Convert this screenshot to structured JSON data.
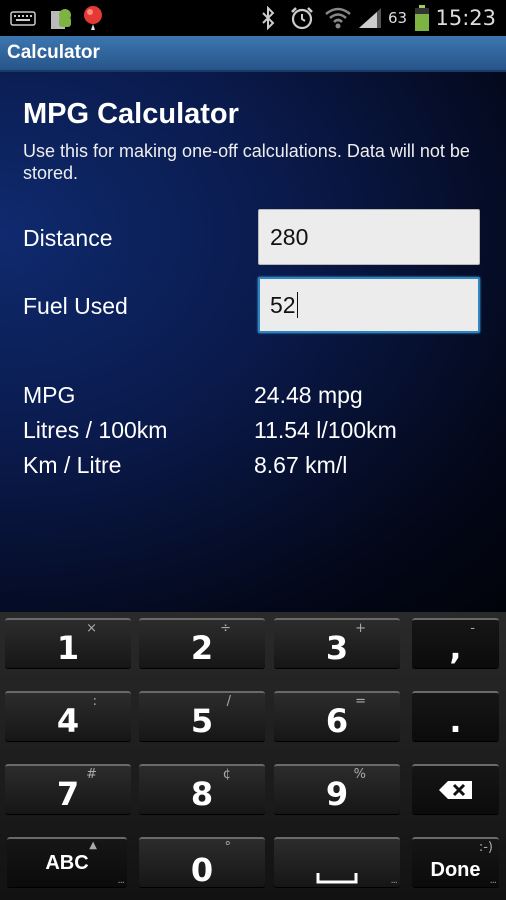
{
  "status_bar": {
    "icons": [
      "keyboard-icon",
      "android-sd-icon",
      "balloon-notification-icon",
      "bluetooth-icon",
      "alarm-icon",
      "wifi-icon",
      "signal-icon",
      "battery-charging-icon"
    ],
    "battery_percent": "63",
    "time": "15:23"
  },
  "title_bar": {
    "title": "Calculator"
  },
  "main": {
    "heading": "MPG Calculator",
    "description": "Use this for making one-off calculations. Data will not be stored.",
    "fields": [
      {
        "label": "Distance",
        "value": "280"
      },
      {
        "label": "Fuel Used",
        "value": "52"
      }
    ],
    "results": [
      {
        "label": "MPG",
        "value": "24.48 mpg"
      },
      {
        "label": "Litres / 100km",
        "value": "11.54 l/100km"
      },
      {
        "label": "Km / Litre",
        "value": "8.67 km/l"
      }
    ]
  },
  "keyboard": {
    "keys": [
      {
        "label": "1",
        "sub": "×"
      },
      {
        "label": "2",
        "sub": "÷"
      },
      {
        "label": "3",
        "sub": "+"
      },
      {
        "label": ",",
        "sub": "-"
      },
      {
        "label": "4",
        "sub": ":"
      },
      {
        "label": "5",
        "sub": "/"
      },
      {
        "label": "6",
        "sub": "="
      },
      {
        "label": ".",
        "sub": ""
      },
      {
        "label": "7",
        "sub": "#"
      },
      {
        "label": "8",
        "sub": "¢"
      },
      {
        "label": "9",
        "sub": "%"
      },
      {
        "label": "ABC",
        "sub": "▲"
      },
      {
        "label": "0",
        "sub": "°"
      },
      {
        "label": "Done",
        "sub": ":-)"
      }
    ]
  }
}
